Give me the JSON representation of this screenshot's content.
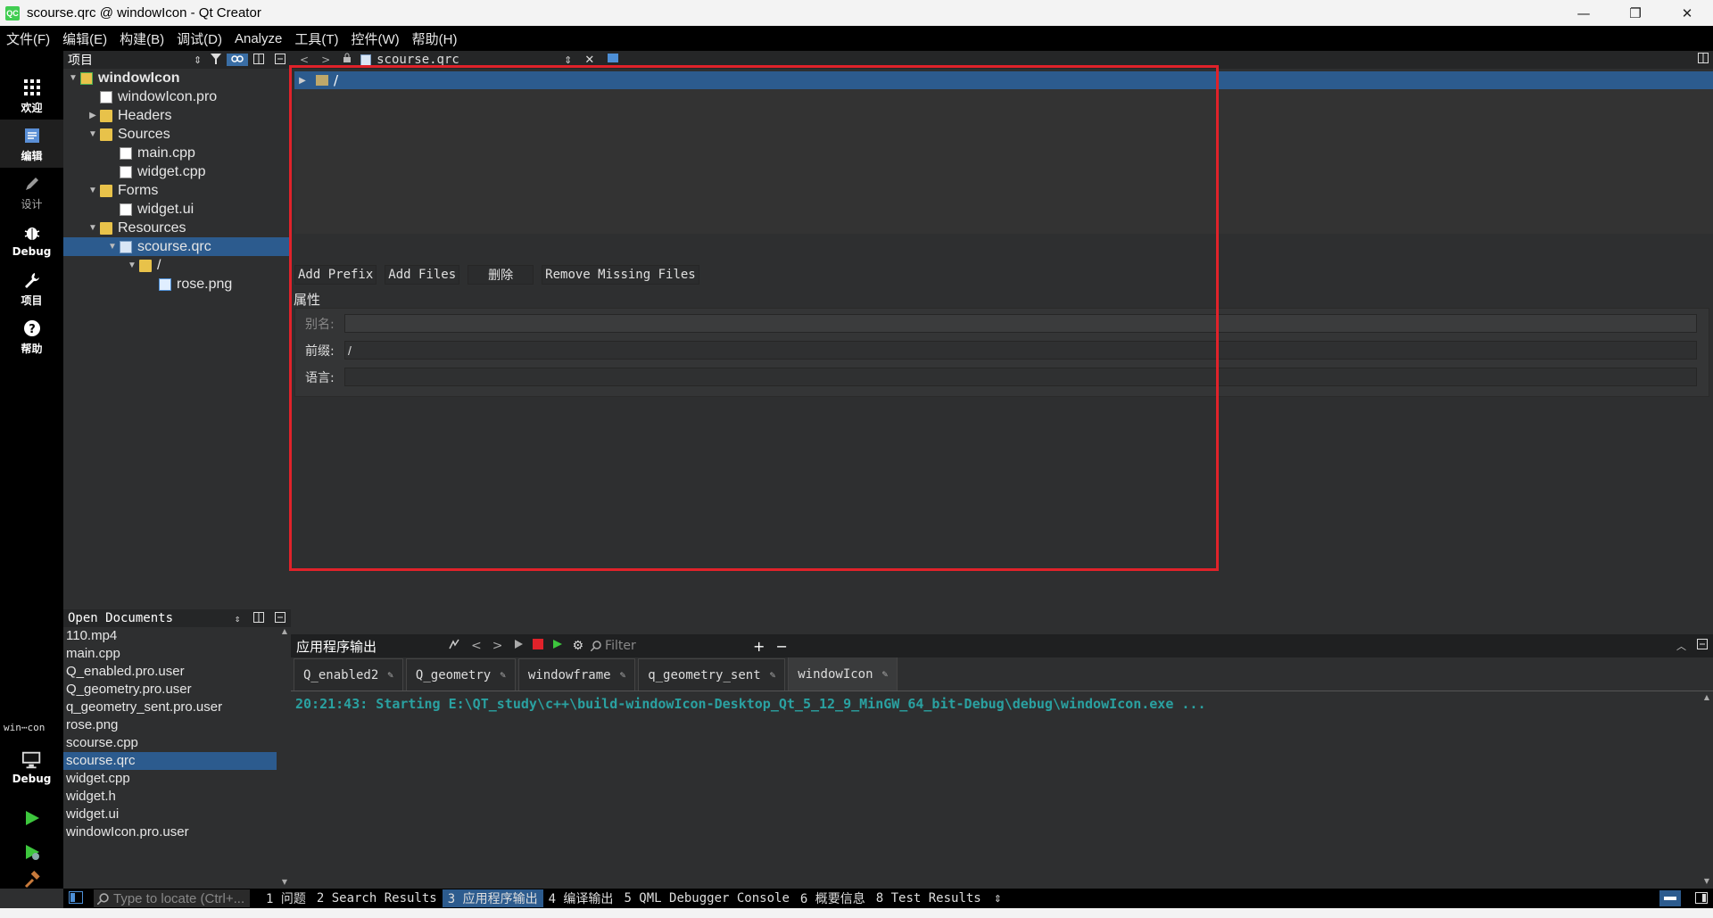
{
  "window": {
    "title": "scourse.qrc @ windowIcon - Qt Creator",
    "logo": "QC",
    "minimize": "—",
    "restore": "❐",
    "close": "✕"
  },
  "menu": [
    "文件(F)",
    "编辑(E)",
    "构建(B)",
    "调试(D)",
    "Analyze",
    "工具(T)",
    "控件(W)",
    "帮助(H)"
  ],
  "modes": {
    "welcome": "欢迎",
    "edit": "编辑",
    "design": "设计",
    "debug": "Debug",
    "projects": "项目",
    "help": "帮助",
    "kit_name": "win⋯con",
    "kit_mode": "Debug"
  },
  "project_panel": {
    "title": "项目",
    "tree": [
      {
        "label": "windowIcon",
        "depth": 0,
        "arrow": "▼",
        "icon": "proj",
        "bold": true
      },
      {
        "label": "windowIcon.pro",
        "depth": 1,
        "arrow": "",
        "icon": "file"
      },
      {
        "label": "Headers",
        "depth": 1,
        "arrow": "▶",
        "icon": "folder"
      },
      {
        "label": "Sources",
        "depth": 1,
        "arrow": "▼",
        "icon": "folder"
      },
      {
        "label": "main.cpp",
        "depth": 2,
        "arrow": "",
        "icon": "file"
      },
      {
        "label": "widget.cpp",
        "depth": 2,
        "arrow": "",
        "icon": "file"
      },
      {
        "label": "Forms",
        "depth": 1,
        "arrow": "▼",
        "icon": "folder"
      },
      {
        "label": "widget.ui",
        "depth": 2,
        "arrow": "",
        "icon": "ui"
      },
      {
        "label": "Resources",
        "depth": 1,
        "arrow": "▼",
        "icon": "folder"
      },
      {
        "label": "scourse.qrc",
        "depth": 2,
        "arrow": "▼",
        "icon": "qrc",
        "selected": true
      },
      {
        "label": "/",
        "depth": 3,
        "arrow": "▼",
        "icon": "folder"
      },
      {
        "label": "rose.png",
        "depth": 4,
        "arrow": "",
        "icon": "img"
      }
    ]
  },
  "open_documents": {
    "title": "Open Documents",
    "items": [
      "110.mp4",
      "main.cpp",
      "Q_enabled.pro.user",
      "Q_geometry.pro.user",
      "q_geometry_sent.pro.user",
      "rose.png",
      "scourse.cpp",
      "scourse.qrc",
      "widget.cpp",
      "widget.h",
      "widget.ui",
      "windowIcon.pro.user"
    ],
    "selected": "scourse.qrc"
  },
  "editor": {
    "file_combo": "scourse.qrc",
    "resource_root": "/",
    "buttons": {
      "add_prefix": "Add Prefix",
      "add_files": "Add Files",
      "delete": "删除",
      "remove_missing": "Remove Missing Files"
    },
    "properties_title": "属性",
    "properties": {
      "alias_label": "别名:",
      "alias_value": "",
      "prefix_label": "前缀:",
      "prefix_value": "/",
      "language_label": "语言:",
      "language_value": ""
    }
  },
  "output": {
    "title": "应用程序输出",
    "filter_placeholder": "Filter",
    "tabs": [
      "Q_enabled2",
      "Q_geometry",
      "windowframe",
      "q_geometry_sent",
      "windowIcon"
    ],
    "active_tab": "windowIcon",
    "text": "20:21:43: Starting E:\\QT_study\\c++\\build-windowIcon-Desktop_Qt_5_12_9_MinGW_64_bit-Debug\\debug\\windowIcon.exe ...",
    "text_color": "#2aa1a1"
  },
  "status": {
    "locate_placeholder": "Type to locate (Ctrl+...",
    "tabs": [
      "1 问题",
      "2 Search Results",
      "3 应用程序输出",
      "4 编译输出",
      "5 QML Debugger Console",
      "6 概要信息",
      "8 Test Results"
    ],
    "active": "3 应用程序输出"
  },
  "colors": {
    "selection": "#2c5b8e",
    "highlight_box": "#e0222a",
    "run_green": "#3dc63d"
  }
}
